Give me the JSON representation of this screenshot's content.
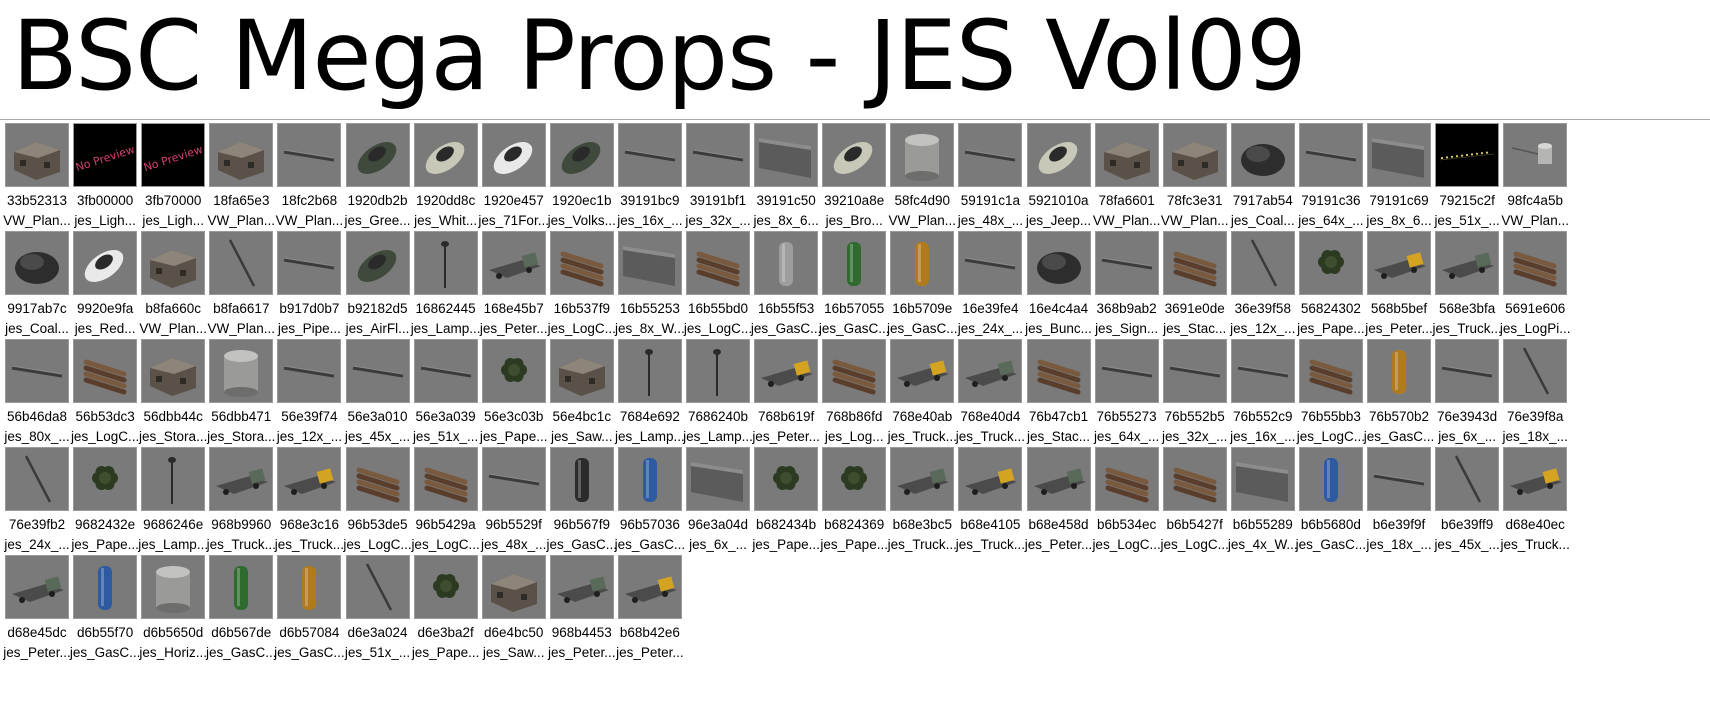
{
  "window": {
    "title": "BSC Mega Props - JES Vol09"
  },
  "icons": {
    "thumbnail_kind_default": "prop-thumbnail",
    "thumbnail_kind_missing": "no-preview-thumbnail",
    "no_preview_text": "No Preview"
  },
  "rows": [
    [
      {
        "id": "33b52313",
        "name": "VW_Plan...",
        "kind": "building"
      },
      {
        "id": "3fb00000",
        "name": "jes_Ligh...",
        "kind": "nopreview"
      },
      {
        "id": "3fb70000",
        "name": "jes_Ligh...",
        "kind": "nopreview"
      },
      {
        "id": "18fa65e3",
        "name": "VW_Plan...",
        "kind": "building"
      },
      {
        "id": "18fc2b68",
        "name": "VW_Plan...",
        "kind": "beam"
      },
      {
        "id": "1920db2b",
        "name": "jes_Gree...",
        "kind": "car"
      },
      {
        "id": "1920dd8c",
        "name": "jes_Whit...",
        "kind": "car"
      },
      {
        "id": "1920e457",
        "name": "jes_71For...",
        "kind": "car"
      },
      {
        "id": "1920ec1b",
        "name": "jes_Volks...",
        "kind": "car"
      },
      {
        "id": "39191bc9",
        "name": "jes_16x_...",
        "kind": "beam"
      },
      {
        "id": "39191bf1",
        "name": "jes_32x_...",
        "kind": "beam"
      },
      {
        "id": "39191c50",
        "name": "jes_8x_6...",
        "kind": "wall"
      },
      {
        "id": "39210a8e",
        "name": "jes_Bro...",
        "kind": "car"
      },
      {
        "id": "58fc4d90",
        "name": "VW_Plan...",
        "kind": "tank"
      },
      {
        "id": "59191c1a",
        "name": "jes_48x_...",
        "kind": "beam"
      },
      {
        "id": "5921010a",
        "name": "jes_Jeep...",
        "kind": "car"
      },
      {
        "id": "78fa6601",
        "name": "VW_Plan...",
        "kind": "building"
      },
      {
        "id": "78fc3e31",
        "name": "VW_Plan...",
        "kind": "building"
      },
      {
        "id": "7917ab54",
        "name": "jes_Coal...",
        "kind": "pile"
      },
      {
        "id": "79191c36",
        "name": "jes_64x_...",
        "kind": "beam"
      },
      {
        "id": "79191c69",
        "name": "jes_8x_6...",
        "kind": "wall"
      },
      {
        "id": "79215c2f",
        "name": "jes_51x_...",
        "kind": "nightlights"
      },
      {
        "id": "98fc4a5b",
        "name": "VW_Plan...",
        "kind": "pipe"
      }
    ],
    [
      {
        "id": "9917ab7c",
        "name": "jes_Coal...",
        "kind": "pile"
      },
      {
        "id": "9920e9fa",
        "name": "jes_Red...",
        "kind": "car"
      },
      {
        "id": "b8fa660c",
        "name": "VW_Plan...",
        "kind": "building"
      },
      {
        "id": "b8fa6617",
        "name": "VW_Plan...",
        "kind": "pole"
      },
      {
        "id": "b917d0b7",
        "name": "jes_Pipe...",
        "kind": "beam"
      },
      {
        "id": "b92182d5",
        "name": "jes_AirFl...",
        "kind": "car"
      },
      {
        "id": "16862445",
        "name": "jes_Lamp...",
        "kind": "lamp"
      },
      {
        "id": "168e45b7",
        "name": "jes_Peter...",
        "kind": "truck"
      },
      {
        "id": "16b537f9",
        "name": "jes_LogC...",
        "kind": "logs"
      },
      {
        "id": "16b55253",
        "name": "jes_8x_W...",
        "kind": "wall"
      },
      {
        "id": "16b55bd0",
        "name": "jes_LogC...",
        "kind": "logs"
      },
      {
        "id": "16b55f53",
        "name": "jes_GasC...",
        "kind": "cylinder"
      },
      {
        "id": "16b57055",
        "name": "jes_GasC...",
        "kind": "cylinder"
      },
      {
        "id": "16b5709e",
        "name": "jes_GasC...",
        "kind": "cylinder"
      },
      {
        "id": "16e39fe4",
        "name": "jes_24x_...",
        "kind": "beam"
      },
      {
        "id": "16e4c4a4",
        "name": "jes_Bunc...",
        "kind": "pile"
      },
      {
        "id": "368b9ab2",
        "name": "jes_Sign...",
        "kind": "beam"
      },
      {
        "id": "3691e0de",
        "name": "jes_Stac...",
        "kind": "logs"
      },
      {
        "id": "36e39f58",
        "name": "jes_12x_...",
        "kind": "pole"
      },
      {
        "id": "56824302",
        "name": "jes_Pape...",
        "kind": "tree"
      },
      {
        "id": "568b5bef",
        "name": "jes_Peter...",
        "kind": "truck"
      },
      {
        "id": "568e3bfa",
        "name": "jes_Truck...",
        "kind": "truck"
      },
      {
        "id": "5691e606",
        "name": "jes_LogPi...",
        "kind": "logs"
      }
    ],
    [
      {
        "id": "56b46da8",
        "name": "jes_80x_...",
        "kind": "beam"
      },
      {
        "id": "56b53dc3",
        "name": "jes_LogC...",
        "kind": "logs"
      },
      {
        "id": "56dbb44c",
        "name": "jes_Stora...",
        "kind": "building"
      },
      {
        "id": "56dbb471",
        "name": "jes_Stora...",
        "kind": "tank"
      },
      {
        "id": "56e39f74",
        "name": "jes_12x_...",
        "kind": "beam"
      },
      {
        "id": "56e3a010",
        "name": "jes_45x_...",
        "kind": "beam"
      },
      {
        "id": "56e3a039",
        "name": "jes_51x_...",
        "kind": "beam"
      },
      {
        "id": "56e3c03b",
        "name": "jes_Pape...",
        "kind": "tree"
      },
      {
        "id": "56e4bc1c",
        "name": "jes_Saw...",
        "kind": "building"
      },
      {
        "id": "7684e692",
        "name": "jes_Lamp...",
        "kind": "lamp"
      },
      {
        "id": "7686240b",
        "name": "jes_Lamp...",
        "kind": "lamp"
      },
      {
        "id": "768b619f",
        "name": "jes_Peter...",
        "kind": "truck"
      },
      {
        "id": "768b86fd",
        "name": "jes_Log...",
        "kind": "logs"
      },
      {
        "id": "768e40ab",
        "name": "jes_Truck...",
        "kind": "truck"
      },
      {
        "id": "768e40d4",
        "name": "jes_Truck...",
        "kind": "truck"
      },
      {
        "id": "76b47cb1",
        "name": "jes_Stac...",
        "kind": "logs"
      },
      {
        "id": "76b55273",
        "name": "jes_64x_...",
        "kind": "beam"
      },
      {
        "id": "76b552b5",
        "name": "jes_32x_...",
        "kind": "beam"
      },
      {
        "id": "76b552c9",
        "name": "jes_16x_...",
        "kind": "beam"
      },
      {
        "id": "76b55bb3",
        "name": "jes_LogC...",
        "kind": "logs"
      },
      {
        "id": "76b570b2",
        "name": "jes_GasC...",
        "kind": "cylinder"
      },
      {
        "id": "76e3943d",
        "name": "jes_6x_...",
        "kind": "beam"
      },
      {
        "id": "76e39f8a",
        "name": "jes_18x_...",
        "kind": "pole"
      }
    ],
    [
      {
        "id": "76e39fb2",
        "name": "jes_24x_...",
        "kind": "pole"
      },
      {
        "id": "9682432e",
        "name": "jes_Pape...",
        "kind": "tree"
      },
      {
        "id": "9686246e",
        "name": "jes_Lamp...",
        "kind": "lamp"
      },
      {
        "id": "968b9960",
        "name": "jes_Truck...",
        "kind": "truck"
      },
      {
        "id": "968e3c16",
        "name": "jes_Truck...",
        "kind": "truck"
      },
      {
        "id": "96b53de5",
        "name": "jes_LogC...",
        "kind": "logs"
      },
      {
        "id": "96b5429a",
        "name": "jes_LogC...",
        "kind": "logs"
      },
      {
        "id": "96b5529f",
        "name": "jes_48x_...",
        "kind": "beam"
      },
      {
        "id": "96b567f9",
        "name": "jes_GasC...",
        "kind": "cylinder"
      },
      {
        "id": "96b57036",
        "name": "jes_GasC...",
        "kind": "cylinder"
      },
      {
        "id": "96e3a04d",
        "name": "jes_6x_...",
        "kind": "wall"
      },
      {
        "id": "b682434b",
        "name": "jes_Pape...",
        "kind": "tree"
      },
      {
        "id": "b6824369",
        "name": "jes_Pape...",
        "kind": "tree"
      },
      {
        "id": "b68e3bc5",
        "name": "jes_Truck...",
        "kind": "truck"
      },
      {
        "id": "b68e4105",
        "name": "jes_Truck...",
        "kind": "truck"
      },
      {
        "id": "b68e458d",
        "name": "jes_Peter...",
        "kind": "truck"
      },
      {
        "id": "b6b534ec",
        "name": "jes_LogC...",
        "kind": "logs"
      },
      {
        "id": "b6b5427f",
        "name": "jes_LogC...",
        "kind": "logs"
      },
      {
        "id": "b6b55289",
        "name": "jes_4x_W...",
        "kind": "wall"
      },
      {
        "id": "b6b5680d",
        "name": "jes_GasC...",
        "kind": "cylinder"
      },
      {
        "id": "b6e39f9f",
        "name": "jes_18x_...",
        "kind": "beam"
      },
      {
        "id": "b6e39ff9",
        "name": "jes_45x_...",
        "kind": "pole"
      },
      {
        "id": "d68e40ec",
        "name": "jes_Truck...",
        "kind": "truck"
      }
    ],
    [
      {
        "id": "d68e45dc",
        "name": "jes_Peter...",
        "kind": "truck"
      },
      {
        "id": "d6b55f70",
        "name": "jes_GasC...",
        "kind": "cylinder"
      },
      {
        "id": "d6b5650d",
        "name": "jes_Horiz...",
        "kind": "tank"
      },
      {
        "id": "d6b567de",
        "name": "jes_GasC...",
        "kind": "cylinder"
      },
      {
        "id": "d6b57084",
        "name": "jes_GasC...",
        "kind": "cylinder"
      },
      {
        "id": "d6e3a024",
        "name": "jes_51x_...",
        "kind": "pole"
      },
      {
        "id": "d6e3ba2f",
        "name": "jes_Pape...",
        "kind": "tree"
      },
      {
        "id": "d6e4bc50",
        "name": "jes_Saw...",
        "kind": "building"
      },
      {
        "id": "968b4453",
        "name": "jes_Peter...",
        "kind": "truck"
      },
      {
        "id": "b68b42e6",
        "name": "jes_Peter...",
        "kind": "truck"
      }
    ]
  ]
}
